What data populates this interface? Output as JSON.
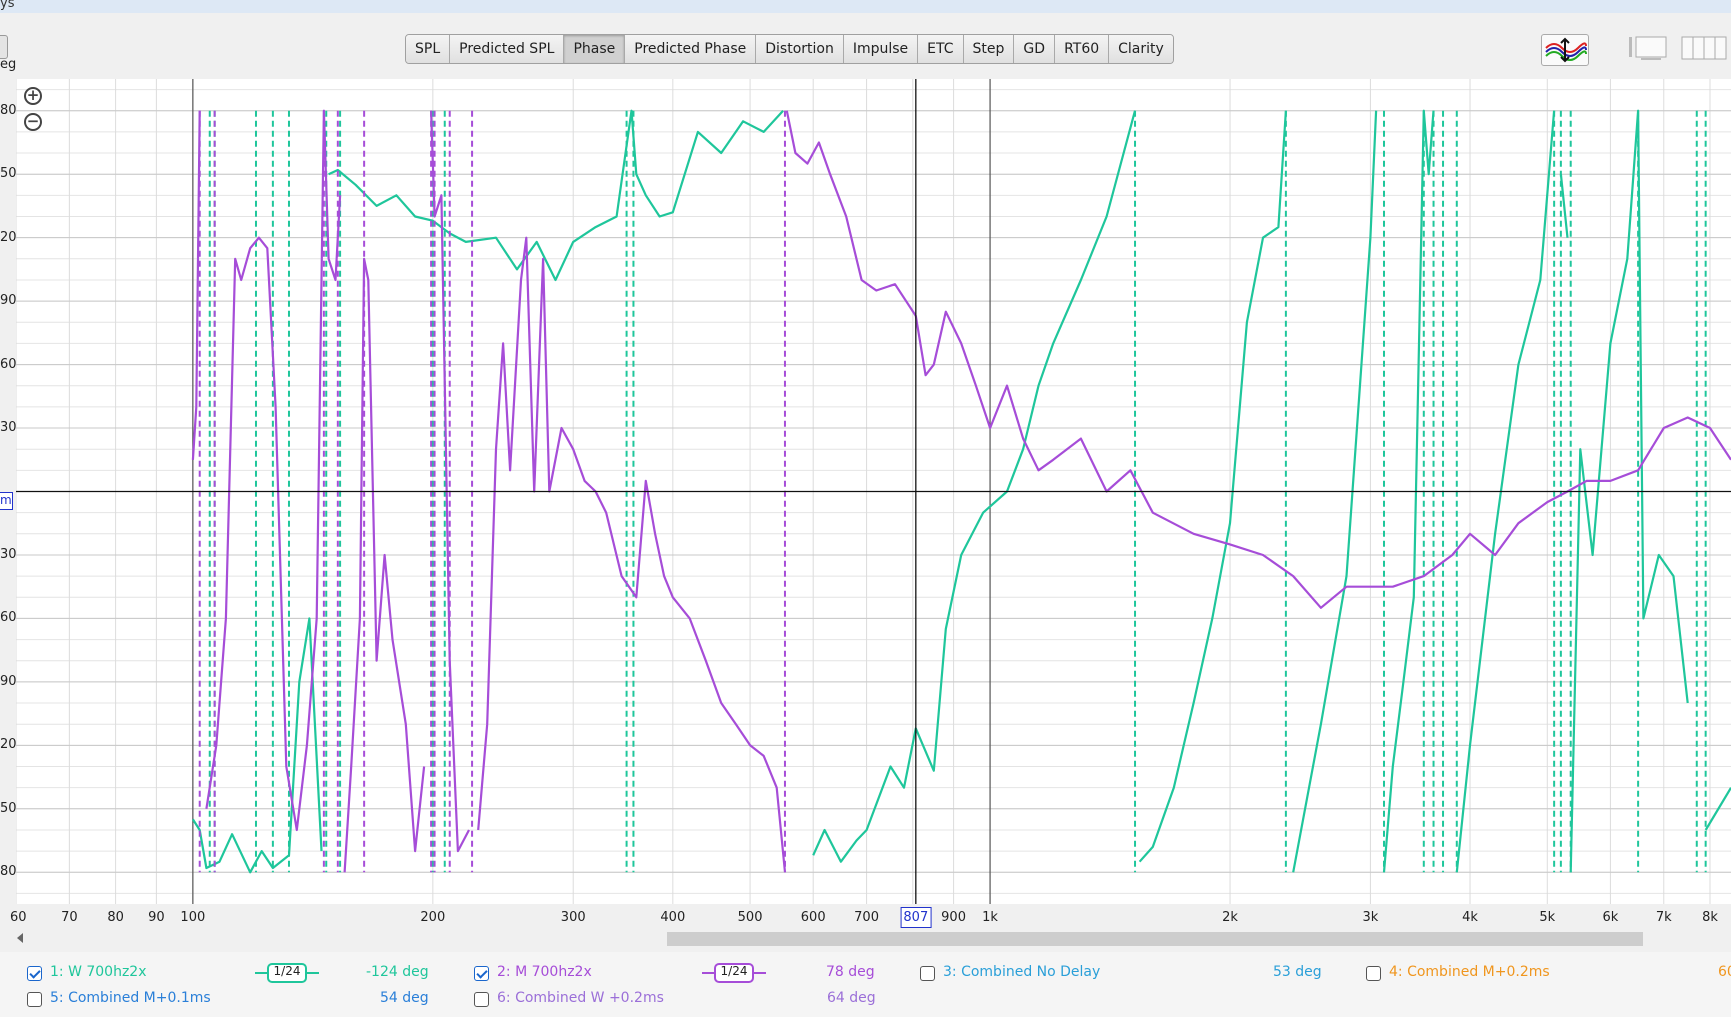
{
  "window": {
    "title": "ys"
  },
  "tabs": [
    {
      "label": "SPL",
      "active": false
    },
    {
      "label": "Predicted SPL",
      "active": false
    },
    {
      "label": "Phase",
      "active": true
    },
    {
      "label": "Predicted Phase",
      "active": false
    },
    {
      "label": "Distortion",
      "active": false
    },
    {
      "label": "Impulse",
      "active": false
    },
    {
      "label": "ETC",
      "active": false
    },
    {
      "label": "Step",
      "active": false
    },
    {
      "label": "GD",
      "active": false
    },
    {
      "label": "RT60",
      "active": false
    },
    {
      "label": "Clarity",
      "active": false
    }
  ],
  "axis": {
    "y_unit": "eg",
    "y_cursor_label": "m",
    "x_cursor_value": "807"
  },
  "chart_data": {
    "type": "line",
    "x_scale": "log",
    "xlim": [
      60,
      8500
    ],
    "ylim": [
      -195,
      195
    ],
    "y_ticks": [
      180,
      150,
      120,
      90,
      60,
      30,
      0,
      -30,
      -60,
      -90,
      -120,
      -150,
      -180
    ],
    "y_tick_labels": [
      "80",
      "50",
      "20",
      "90",
      "60",
      "30",
      "",
      "30",
      "60",
      "90",
      "20",
      "50",
      "80"
    ],
    "x_ticks": [
      60,
      70,
      80,
      90,
      100,
      200,
      300,
      400,
      500,
      600,
      700,
      800,
      900,
      1000,
      2000,
      3000,
      4000,
      5000,
      6000,
      7000,
      8000
    ],
    "x_tick_labels": [
      "60",
      "70",
      "80",
      "90",
      "100",
      "200",
      "300",
      "400",
      "500",
      "600",
      "700",
      "",
      "900",
      "1k",
      "2k",
      "3k",
      "4k",
      "5k",
      "6k",
      "7k",
      "8k"
    ],
    "cursor": {
      "x": 807,
      "y": 0
    },
    "grid": true,
    "series": [
      {
        "name": "1: W 700hz2x",
        "color": "#1fc69b",
        "wraps": [
          105,
          106.5,
          120,
          126,
          132,
          147,
          153,
          200,
          207,
          350,
          357,
          1520,
          2350,
          3120,
          3500,
          3600,
          3700,
          3850,
          5100,
          5200,
          5350,
          6500,
          7700,
          7900
        ],
        "points": [
          [
            100,
            -155
          ],
          [
            102,
            -160
          ],
          [
            104,
            -178
          ],
          [
            108,
            -175
          ],
          [
            112,
            -162
          ],
          [
            118,
            -180
          ],
          [
            122,
            -170
          ],
          [
            126,
            -178
          ],
          [
            132,
            -172
          ],
          [
            136,
            -90
          ],
          [
            140,
            -60
          ],
          [
            145,
            -170
          ],
          [
            148,
            150
          ],
          [
            152,
            152
          ],
          [
            160,
            145
          ],
          [
            170,
            135
          ],
          [
            180,
            140
          ],
          [
            190,
            130
          ],
          [
            200,
            128
          ],
          [
            210,
            122
          ],
          [
            220,
            118
          ],
          [
            240,
            120
          ],
          [
            255,
            105
          ],
          [
            270,
            118
          ],
          [
            285,
            100
          ],
          [
            300,
            118
          ],
          [
            320,
            125
          ],
          [
            340,
            130
          ],
          [
            355,
            180
          ],
          [
            360,
            150
          ],
          [
            370,
            140
          ],
          [
            385,
            130
          ],
          [
            400,
            132
          ],
          [
            430,
            170
          ],
          [
            460,
            160
          ],
          [
            490,
            175
          ],
          [
            520,
            170
          ],
          [
            550,
            180
          ],
          [
            600,
            -172
          ],
          [
            620,
            -160
          ],
          [
            650,
            -175
          ],
          [
            680,
            -165
          ],
          [
            700,
            -160
          ],
          [
            750,
            -130
          ],
          [
            780,
            -140
          ],
          [
            807,
            -112
          ],
          [
            850,
            -132
          ],
          [
            880,
            -65
          ],
          [
            920,
            -30
          ],
          [
            980,
            -10
          ],
          [
            1050,
            0
          ],
          [
            1100,
            20
          ],
          [
            1150,
            50
          ],
          [
            1200,
            70
          ],
          [
            1300,
            100
          ],
          [
            1400,
            130
          ],
          [
            1520,
            180
          ],
          [
            1540,
            -175
          ],
          [
            1600,
            -168
          ],
          [
            1700,
            -140
          ],
          [
            1800,
            -100
          ],
          [
            1900,
            -60
          ],
          [
            2000,
            -15
          ],
          [
            2100,
            80
          ],
          [
            2200,
            120
          ],
          [
            2300,
            125
          ],
          [
            2350,
            180
          ],
          [
            2400,
            -180
          ],
          [
            2600,
            -110
          ],
          [
            2800,
            -40
          ],
          [
            3000,
            120
          ],
          [
            3050,
            180
          ],
          [
            3120,
            -180
          ],
          [
            3200,
            -130
          ],
          [
            3300,
            -90
          ],
          [
            3400,
            -50
          ],
          [
            3500,
            180
          ],
          [
            3550,
            150
          ],
          [
            3600,
            180
          ],
          [
            3700,
            -180
          ],
          [
            3800,
            150
          ],
          [
            3850,
            -180
          ],
          [
            4000,
            -120
          ],
          [
            4300,
            -20
          ],
          [
            4600,
            60
          ],
          [
            4900,
            100
          ],
          [
            5100,
            180
          ],
          [
            5150,
            -180
          ],
          [
            5200,
            150
          ],
          [
            5300,
            120
          ],
          [
            5350,
            -180
          ],
          [
            5500,
            20
          ],
          [
            5700,
            -30
          ],
          [
            6000,
            70
          ],
          [
            6300,
            110
          ],
          [
            6500,
            180
          ],
          [
            6600,
            -60
          ],
          [
            6900,
            -30
          ],
          [
            7200,
            -40
          ],
          [
            7500,
            -100
          ],
          [
            7700,
            180
          ],
          [
            7900,
            -160
          ],
          [
            8500,
            -140
          ]
        ]
      },
      {
        "name": "2: M 700hz2x",
        "color": "#a64dd8",
        "wraps": [
          102,
          106.5,
          146,
          152,
          164,
          199,
          201,
          210,
          224,
          553
        ],
        "points": [
          [
            100,
            15
          ],
          [
            101,
            40
          ],
          [
            102,
            180
          ],
          [
            104,
            -150
          ],
          [
            107,
            -120
          ],
          [
            110,
            -60
          ],
          [
            113,
            110
          ],
          [
            115,
            100
          ],
          [
            118,
            115
          ],
          [
            121,
            120
          ],
          [
            124,
            115
          ],
          [
            127,
            40
          ],
          [
            131,
            -130
          ],
          [
            135,
            -160
          ],
          [
            139,
            -120
          ],
          [
            143,
            -60
          ],
          [
            146,
            180
          ],
          [
            148,
            110
          ],
          [
            151,
            100
          ],
          [
            153,
            140
          ],
          [
            155,
            -180
          ],
          [
            158,
            -130
          ],
          [
            162,
            -60
          ],
          [
            164,
            110
          ],
          [
            166,
            100
          ],
          [
            170,
            -80
          ],
          [
            174,
            -30
          ],
          [
            178,
            -70
          ],
          [
            185,
            -110
          ],
          [
            190,
            -170
          ],
          [
            195,
            -130
          ],
          [
            199,
            180
          ],
          [
            201,
            130
          ],
          [
            205,
            140
          ],
          [
            210,
            -80
          ],
          [
            215,
            -170
          ],
          [
            222,
            -160
          ],
          [
            224,
            180
          ],
          [
            228,
            -160
          ],
          [
            234,
            -110
          ],
          [
            240,
            20
          ],
          [
            245,
            70
          ],
          [
            250,
            10
          ],
          [
            258,
            100
          ],
          [
            262,
            120
          ],
          [
            268,
            0
          ],
          [
            275,
            110
          ],
          [
            280,
            0
          ],
          [
            290,
            30
          ],
          [
            300,
            20
          ],
          [
            310,
            5
          ],
          [
            320,
            0
          ],
          [
            330,
            -10
          ],
          [
            345,
            -40
          ],
          [
            360,
            -50
          ],
          [
            370,
            5
          ],
          [
            380,
            -20
          ],
          [
            390,
            -40
          ],
          [
            400,
            -50
          ],
          [
            420,
            -60
          ],
          [
            440,
            -80
          ],
          [
            460,
            -100
          ],
          [
            480,
            -110
          ],
          [
            500,
            -120
          ],
          [
            520,
            -125
          ],
          [
            540,
            -140
          ],
          [
            553,
            -180
          ],
          [
            556,
            180
          ],
          [
            570,
            160
          ],
          [
            590,
            155
          ],
          [
            610,
            165
          ],
          [
            630,
            150
          ],
          [
            660,
            130
          ],
          [
            690,
            100
          ],
          [
            720,
            95
          ],
          [
            760,
            98
          ],
          [
            807,
            83
          ],
          [
            830,
            55
          ],
          [
            850,
            60
          ],
          [
            880,
            85
          ],
          [
            920,
            70
          ],
          [
            960,
            50
          ],
          [
            1000,
            30
          ],
          [
            1050,
            50
          ],
          [
            1100,
            25
          ],
          [
            1150,
            10
          ],
          [
            1200,
            15
          ],
          [
            1300,
            25
          ],
          [
            1400,
            0
          ],
          [
            1500,
            10
          ],
          [
            1600,
            -10
          ],
          [
            1800,
            -20
          ],
          [
            2000,
            -25
          ],
          [
            2200,
            -30
          ],
          [
            2400,
            -40
          ],
          [
            2600,
            -55
          ],
          [
            2800,
            -45
          ],
          [
            3000,
            -45
          ],
          [
            3200,
            -45
          ],
          [
            3500,
            -40
          ],
          [
            3800,
            -30
          ],
          [
            4000,
            -20
          ],
          [
            4300,
            -30
          ],
          [
            4600,
            -15
          ],
          [
            5000,
            -5
          ],
          [
            5300,
            0
          ],
          [
            5600,
            5
          ],
          [
            6000,
            5
          ],
          [
            6500,
            10
          ],
          [
            7000,
            30
          ],
          [
            7500,
            35
          ],
          [
            8000,
            30
          ],
          [
            8500,
            15
          ]
        ]
      }
    ]
  },
  "legend": [
    {
      "label": "1: W 700hz2x",
      "checked": true,
      "smoothing": "1/24",
      "value": "-124 deg",
      "color": "#1fc69b"
    },
    {
      "label": "2: M 700hz2x",
      "checked": true,
      "smoothing": "1/24",
      "value": "78 deg",
      "color": "#a64dd8"
    },
    {
      "label": "3: Combined No Delay",
      "checked": false,
      "smoothing": "",
      "value": "53 deg",
      "color": "#2a9fd8"
    },
    {
      "label": "4: Combined M+0.2ms",
      "checked": false,
      "smoothing": "",
      "value": "60",
      "color": "#f0961e"
    },
    {
      "label": "5: Combined M+0.1ms",
      "checked": false,
      "smoothing": "",
      "value": "54 deg",
      "color": "#2a7fd8"
    },
    {
      "label": "6: Combined W +0.2ms",
      "checked": false,
      "smoothing": "",
      "value": "64 deg",
      "color": "#9b6fd8"
    }
  ]
}
